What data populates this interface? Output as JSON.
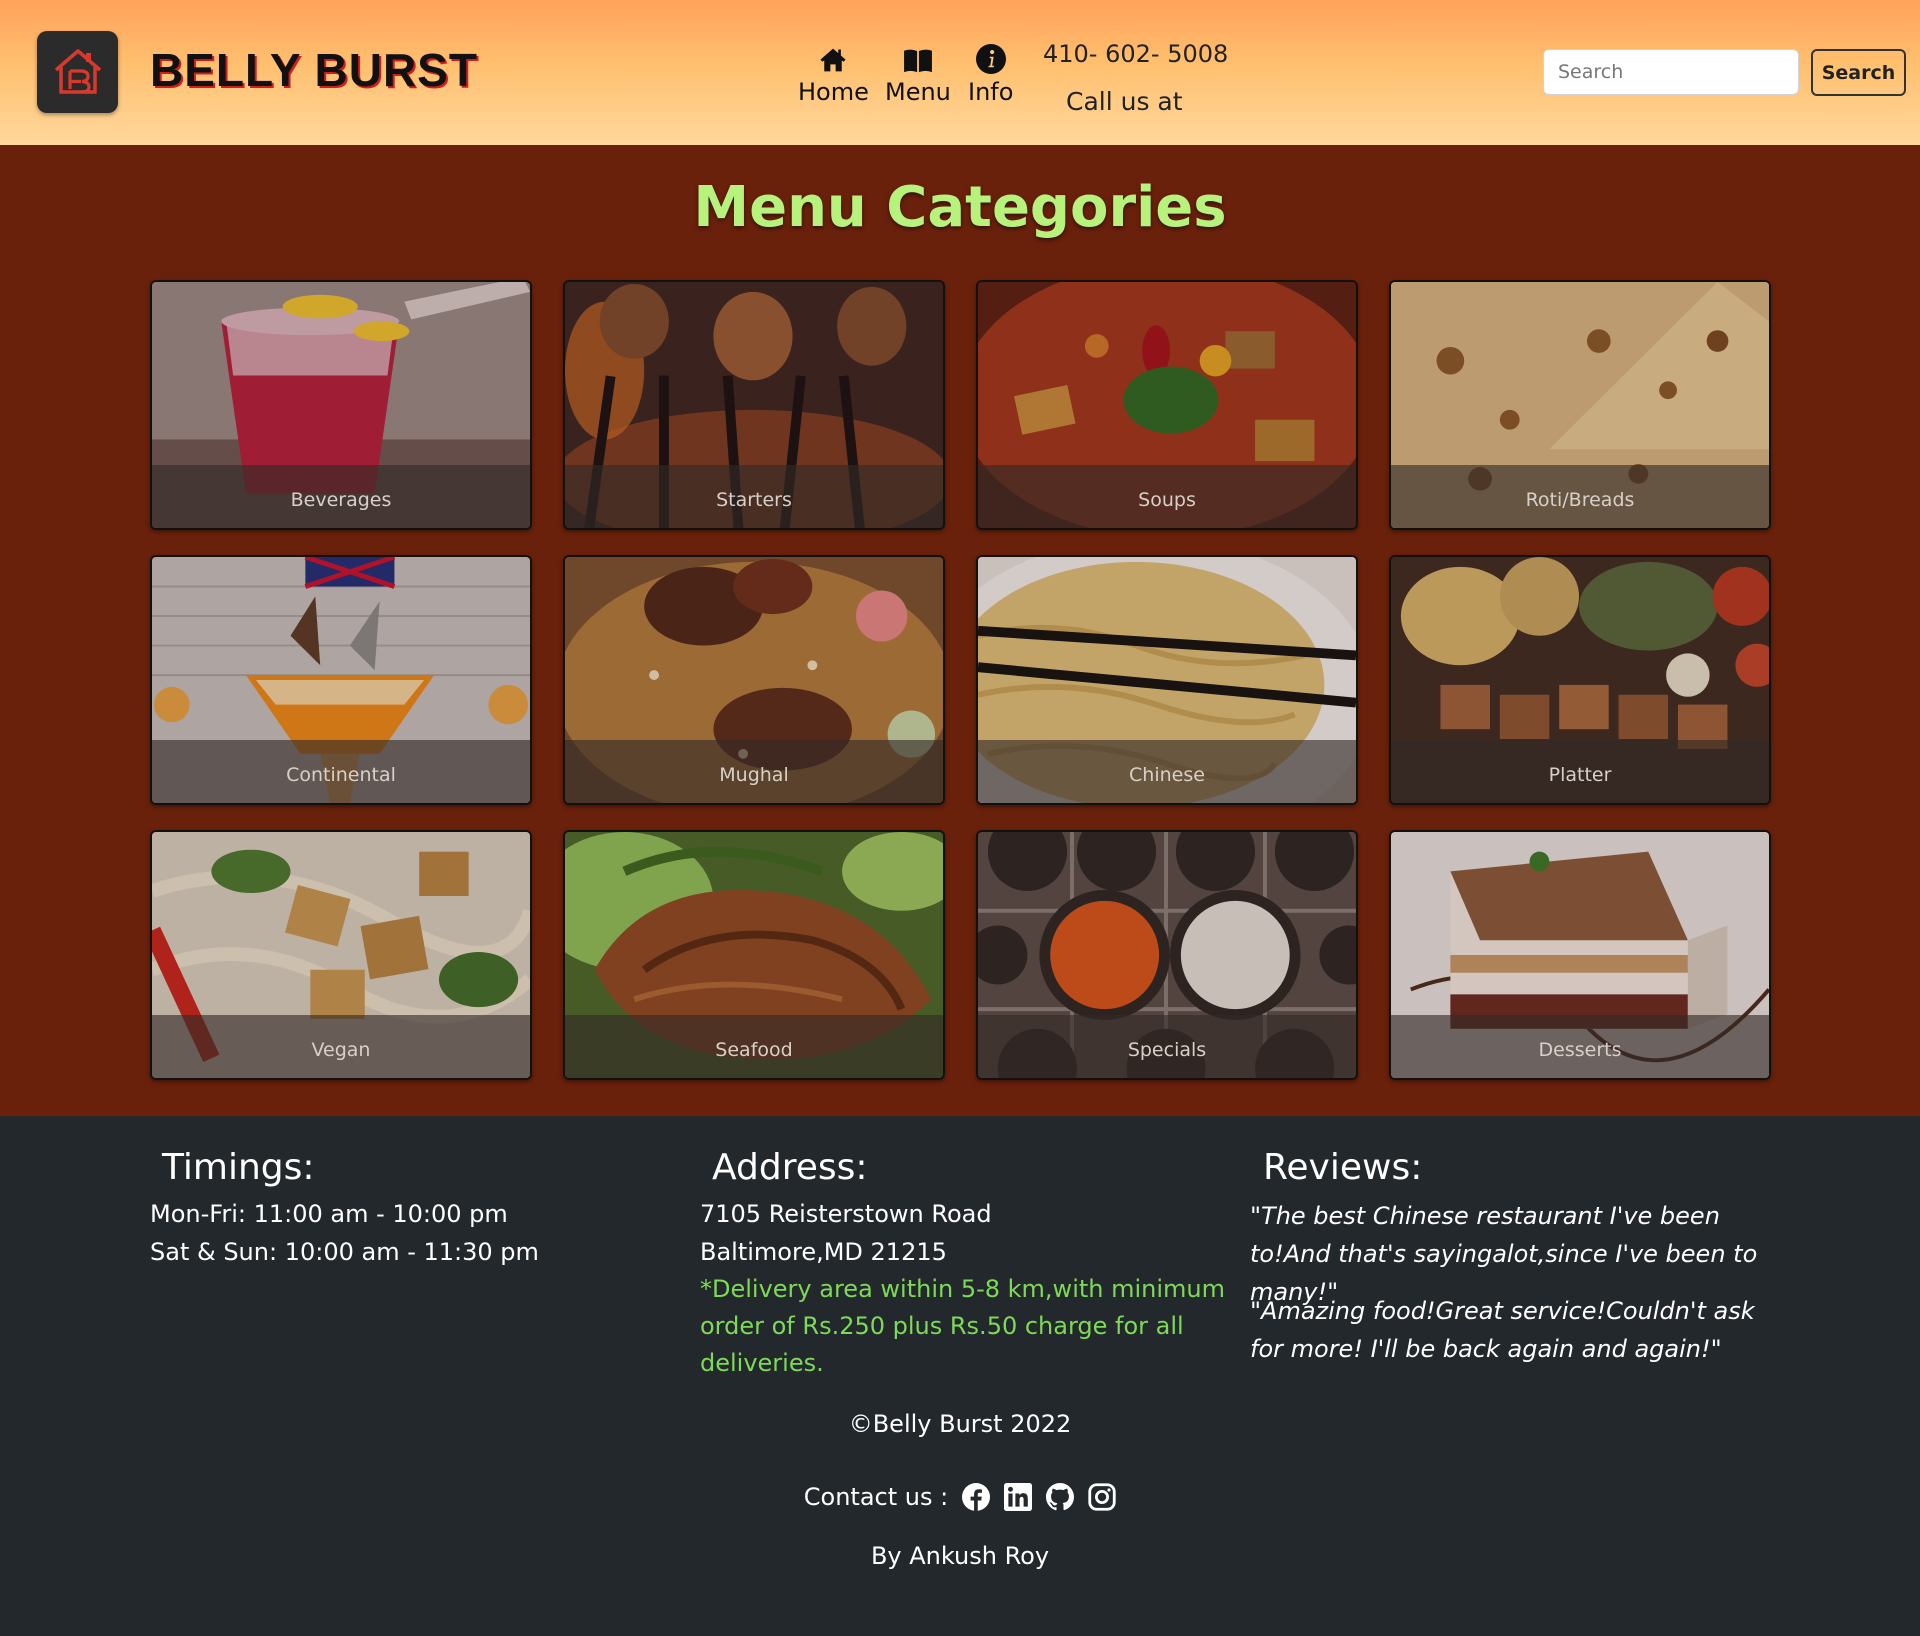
{
  "brand": {
    "name": "BELLY BURST",
    "logo_icon": "house-b-logo-icon",
    "accent": "#d21d1d"
  },
  "nav": {
    "items": [
      {
        "label": "Home",
        "icon": "home-icon"
      },
      {
        "label": "Menu",
        "icon": "book-icon"
      },
      {
        "label": "Info",
        "icon": "info-icon"
      }
    ],
    "phone": "410- 602- 5008",
    "call_text": "Call us at"
  },
  "search": {
    "placeholder": "Search",
    "value": "",
    "button_label": "Search"
  },
  "main": {
    "title": "Menu Categories",
    "title_color": "#b7f27d",
    "background": "#6a210b",
    "categories": [
      {
        "label": "Beverages"
      },
      {
        "label": "Starters"
      },
      {
        "label": "Soups"
      },
      {
        "label": "Roti/Breads"
      },
      {
        "label": "Continental"
      },
      {
        "label": "Mughal"
      },
      {
        "label": "Chinese"
      },
      {
        "label": "Platter"
      },
      {
        "label": "Vegan"
      },
      {
        "label": "Seafood"
      },
      {
        "label": "Specials"
      },
      {
        "label": "Desserts"
      }
    ]
  },
  "footer": {
    "timings": {
      "title": "Timings:",
      "lines": [
        "Mon-Fri: 11:00 am - 10:00 pm",
        "Sat & Sun: 10:00 am - 11:30 pm"
      ]
    },
    "address": {
      "title": "Address:",
      "lines": [
        "7105 Reisterstown Road",
        "Baltimore,MD 21215"
      ],
      "note_lines": [
        "*Delivery area within 5-8 km,with minimum",
        "order of Rs.250 plus Rs.50 charge for all",
        "deliveries."
      ],
      "note_color": "#7ed957"
    },
    "reviews": {
      "title": "Reviews:",
      "items": [
        "\"The best Chinese restaurant I've been to!And that's sayingalot,since I've been to many!\"",
        "\"Amazing food!Great service!Couldn't ask for more! I'll be back again and again!\""
      ]
    },
    "copyright": "©Belly Burst 2022",
    "contact_label": "Contact us :",
    "social": [
      "facebook-icon",
      "linkedin-icon",
      "github-icon",
      "instagram-icon"
    ],
    "byline": "By Ankush Roy"
  }
}
